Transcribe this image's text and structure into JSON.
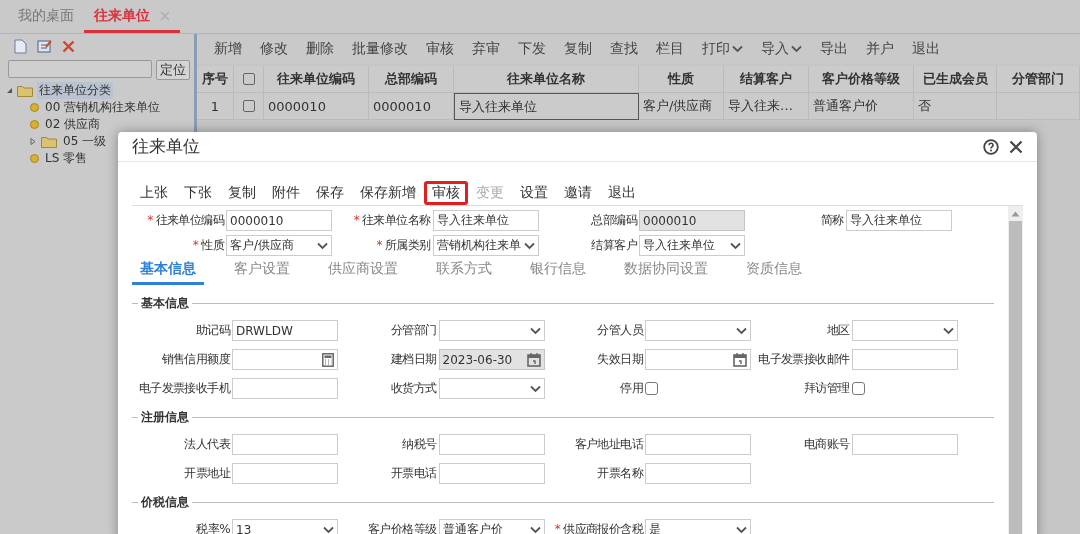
{
  "app_tabs": [
    {
      "label": "我的桌面",
      "selected": false,
      "closable": false
    },
    {
      "label": "往来单位",
      "selected": true,
      "closable": true
    }
  ],
  "sidebar": {
    "locate_button": "定位",
    "tree": [
      {
        "label": "往来单位分类",
        "kind": "folder",
        "expanded": true,
        "selected": true,
        "children": [
          {
            "label": "00 营销机构往来单位",
            "kind": "leaf",
            "selected": false
          },
          {
            "label": "02 供应商",
            "kind": "leaf",
            "selected": false
          },
          {
            "label": "05 一级",
            "kind": "folder",
            "expanded": false,
            "selected": false
          },
          {
            "label": "LS 零售",
            "kind": "leaf",
            "selected": false
          }
        ]
      }
    ]
  },
  "toolbar": [
    {
      "label": "新增",
      "has_menu": false
    },
    {
      "label": "修改",
      "has_menu": false
    },
    {
      "label": "删除",
      "has_menu": false
    },
    {
      "label": "批量修改",
      "has_menu": false
    },
    {
      "label": "审核",
      "has_menu": false
    },
    {
      "label": "弃审",
      "has_menu": false
    },
    {
      "label": "下发",
      "has_menu": false
    },
    {
      "label": "复制",
      "has_menu": false
    },
    {
      "label": "查找",
      "has_menu": false
    },
    {
      "label": "栏目",
      "has_menu": false
    },
    {
      "label": "打印",
      "has_menu": true
    },
    {
      "label": "导入",
      "has_menu": true
    },
    {
      "label": "导出",
      "has_menu": false
    },
    {
      "label": "并户",
      "has_menu": false
    },
    {
      "label": "退出",
      "has_menu": false
    }
  ],
  "table": {
    "number_column": "序号",
    "header_checked": false,
    "columns": [
      "往来单位编码",
      "总部编码",
      "往来单位名称",
      "性质",
      "结算客户",
      "客户价格等级",
      "已生成会员",
      "分管部门"
    ],
    "rows": [
      {
        "number": "1",
        "checked": false,
        "cells": [
          {
            "text": "0000010",
            "focused": false
          },
          {
            "text": "0000010",
            "focused": false
          },
          {
            "text": "导入往来单位",
            "focused": true
          },
          {
            "text": "客户/供应商",
            "focused": false
          },
          {
            "text": "导入往来…",
            "focused": false
          },
          {
            "text": "普通客户价",
            "focused": false
          },
          {
            "text": "否",
            "focused": false
          }
        ]
      }
    ]
  },
  "dialog": {
    "title": "往来单位",
    "toolbar": [
      {
        "label": "上张",
        "disabled": false,
        "highlighted": false
      },
      {
        "label": "下张",
        "disabled": false,
        "highlighted": false
      },
      {
        "label": "复制",
        "disabled": false,
        "highlighted": false
      },
      {
        "label": "附件",
        "disabled": false,
        "highlighted": false
      },
      {
        "label": "保存",
        "disabled": false,
        "highlighted": false
      },
      {
        "label": "保存新增",
        "disabled": false,
        "highlighted": false
      },
      {
        "label": "审核",
        "disabled": false,
        "highlighted": true
      },
      {
        "label": "变更",
        "disabled": true,
        "highlighted": false
      },
      {
        "label": "设置",
        "disabled": false,
        "highlighted": false
      },
      {
        "label": "邀请",
        "disabled": false,
        "highlighted": false
      },
      {
        "label": "退出",
        "disabled": false,
        "highlighted": false
      }
    ],
    "header_fields": [
      {
        "mark": "*",
        "label": "往来单位编码",
        "kind": "text",
        "value": "0000010",
        "readonly": false
      },
      {
        "mark": "*",
        "label": "往来单位名称",
        "kind": "text",
        "value": "导入往来单位",
        "readonly": false
      },
      {
        "label": "总部编码",
        "kind": "text",
        "value": "0000010",
        "readonly": true
      },
      {
        "label": "简称",
        "kind": "text",
        "value": "导入往来单位",
        "readonly": false
      },
      {
        "mark": "*",
        "label": "性质",
        "kind": "select",
        "value": "客户/供应商",
        "readonly": false
      },
      {
        "mark": "*",
        "label": "所属类别",
        "kind": "select",
        "value": "营销机构往来单",
        "readonly": false
      },
      {
        "label": "结算客户",
        "kind": "select",
        "value": "导入往来单位",
        "readonly": false
      }
    ],
    "tabs": [
      {
        "label": "基本信息",
        "selected": true
      },
      {
        "label": "客户设置",
        "selected": false
      },
      {
        "label": "供应商设置",
        "selected": false
      },
      {
        "label": "联系方式",
        "selected": false
      },
      {
        "label": "银行信息",
        "selected": false
      },
      {
        "label": "数据协同设置",
        "selected": false
      },
      {
        "label": "资质信息",
        "selected": false
      }
    ],
    "sections": [
      {
        "title": "基本信息",
        "fields": [
          {
            "label": "助记码",
            "kind": "text",
            "value": "DRWLDW",
            "readonly": false
          },
          {
            "label": "分管部门",
            "kind": "select",
            "readonly": false
          },
          {
            "label": "分管人员",
            "kind": "select",
            "readonly": false
          },
          {
            "label": "地区",
            "kind": "select",
            "readonly": false
          },
          {
            "label": "销售信用额度",
            "kind": "number",
            "readonly": false
          },
          {
            "label": "建档日期",
            "kind": "date",
            "value": "2023-06-30",
            "readonly": true
          },
          {
            "label": "失效日期",
            "kind": "date",
            "readonly": false
          },
          {
            "label": "电子发票接收邮件",
            "kind": "text",
            "readonly": false
          },
          {
            "label": "电子发票接收手机",
            "kind": "text",
            "readonly": false
          },
          {
            "label": "收货方式",
            "kind": "select",
            "readonly": false
          },
          {
            "label": "停用",
            "kind": "checkbox",
            "checked": false
          },
          {
            "label": "拜访管理",
            "kind": "checkbox",
            "checked": false
          }
        ]
      },
      {
        "title": "注册信息",
        "fields": [
          {
            "label": "法人代表",
            "kind": "text",
            "readonly": false
          },
          {
            "label": "纳税号",
            "kind": "text",
            "readonly": false
          },
          {
            "label": "客户地址电话",
            "kind": "text",
            "readonly": false
          },
          {
            "label": "电商账号",
            "kind": "text",
            "readonly": false
          },
          {
            "label": "开票地址",
            "kind": "text",
            "readonly": false
          },
          {
            "label": "开票电话",
            "kind": "text",
            "readonly": false
          },
          {
            "label": "开票名称",
            "kind": "text",
            "readonly": false
          }
        ]
      },
      {
        "title": "价税信息",
        "fields": [
          {
            "label": "税率%",
            "kind": "select",
            "value": "13",
            "readonly": false
          },
          {
            "label": "客户价格等级",
            "kind": "select",
            "value": "普通客户价",
            "readonly": false
          },
          {
            "mark": "*",
            "label": "供应商报价含税",
            "kind": "select",
            "value": "是",
            "readonly": false
          }
        ]
      }
    ]
  }
}
